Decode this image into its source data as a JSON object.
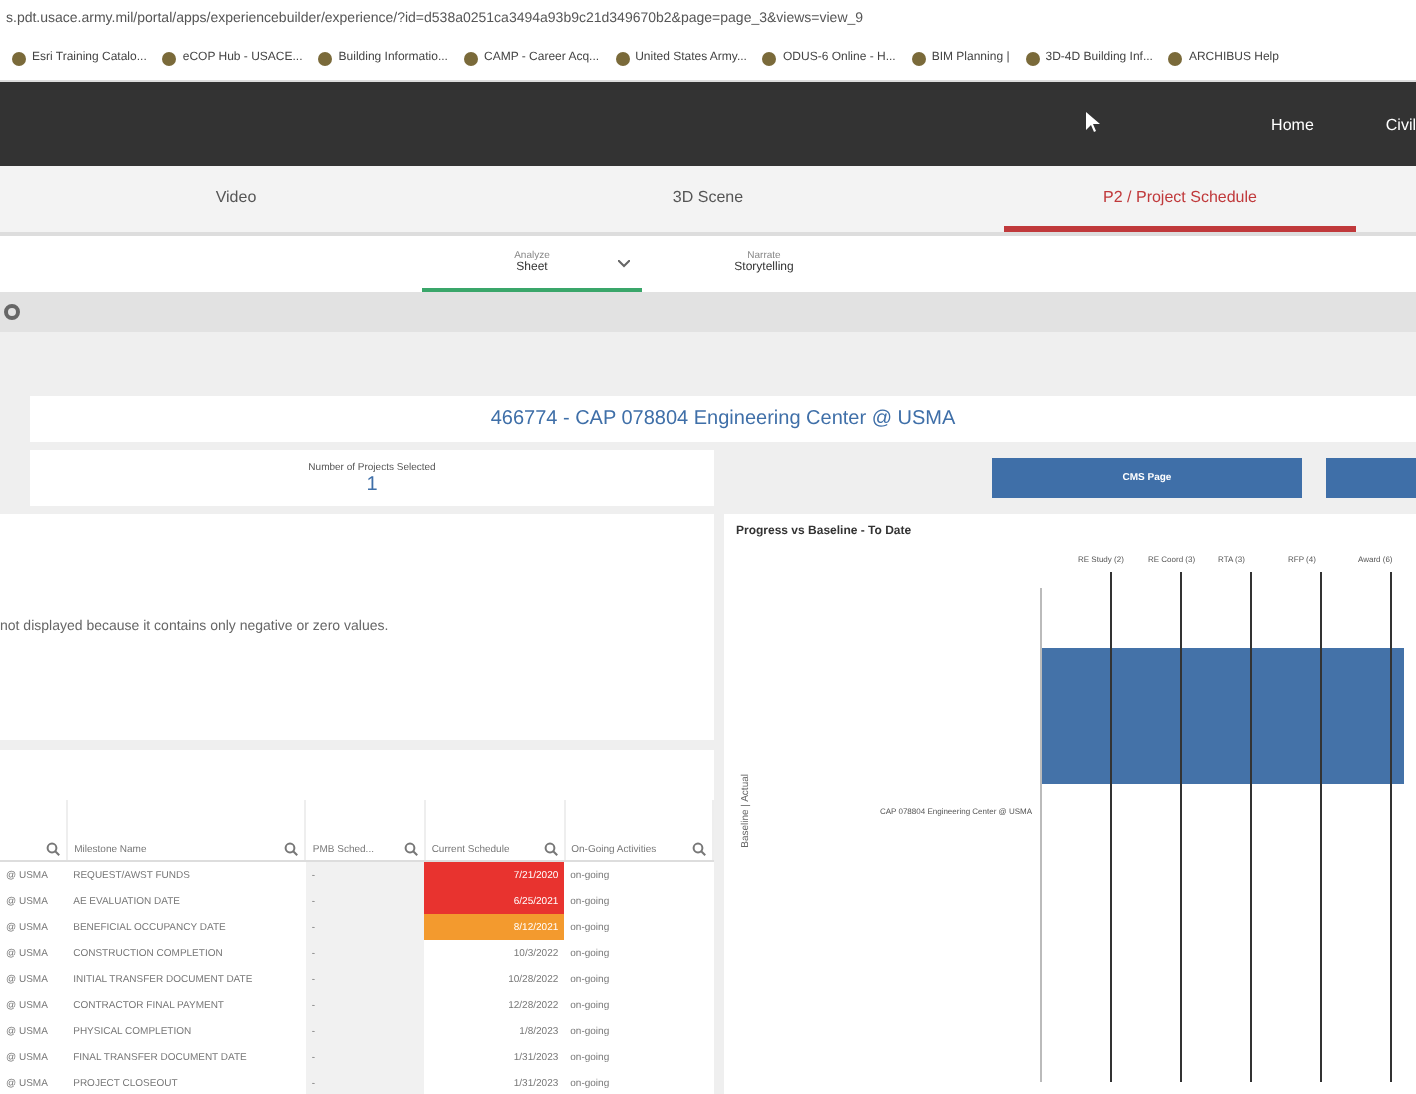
{
  "browser": {
    "url": "s.pdt.usace.army.mil/portal/apps/experiencebuilder/experience/?id=d538a0251ca3494a93b9c21d349670b2&page=page_3&views=view_9",
    "bookmarks": [
      "Esri Training Catalo...",
      "eCOP Hub - USACE...",
      "Building Informatio...",
      "CAMP - Career Acq...",
      "United States Army...",
      "ODUS-6 Online - H...",
      "BIM Planning |",
      "3D-4D Building Inf...",
      "ARCHIBUS Help"
    ]
  },
  "header": {
    "nav": [
      "Home",
      "Civil"
    ]
  },
  "tabs": [
    {
      "label": "Video",
      "selected": false
    },
    {
      "label": "3D Scene",
      "selected": false
    },
    {
      "label": "P2 / Project Schedule",
      "selected": true
    }
  ],
  "views": [
    {
      "caption": "Analyze",
      "label": "Sheet",
      "selected": true,
      "dropdown": true
    },
    {
      "caption": "Narrate",
      "label": "Storytelling",
      "selected": false,
      "dropdown": false
    }
  ],
  "title": "466774 - CAP 078804 Engineering Center @ USMA",
  "kpi": {
    "label": "Number of Projects Selected",
    "value": "1"
  },
  "buttons": [
    {
      "kind": "labeled",
      "label": "CMS Page"
    },
    {
      "kind": "blank"
    }
  ],
  "message": "not displayed because it contains only negative or zero values.",
  "table": {
    "columns": [
      "",
      "Milestone Name",
      "PMB Sched...",
      "Current Schedule",
      "On-Going Activities"
    ],
    "rows": [
      {
        "cells": [
          "@ USMA",
          "REQUEST/AWST FUNDS",
          "-",
          "7/21/2020",
          "on-going"
        ],
        "color": "#e8332f"
      },
      {
        "cells": [
          "@ USMA",
          "AE EVALUATION DATE",
          "-",
          "6/25/2021",
          "on-going"
        ],
        "color": "#e8332f"
      },
      {
        "cells": [
          "@ USMA",
          "BENEFICIAL OCCUPANCY DATE",
          "-",
          "8/12/2021",
          "on-going"
        ],
        "color": "#f39a2e"
      },
      {
        "cells": [
          "@ USMA",
          "CONSTRUCTION COMPLETION",
          "-",
          "10/3/2022",
          "on-going"
        ]
      },
      {
        "cells": [
          "@ USMA",
          "INITIAL TRANSFER DOCUMENT DATE",
          "-",
          "10/28/2022",
          "on-going"
        ]
      },
      {
        "cells": [
          "@ USMA",
          "CONTRACTOR FINAL PAYMENT",
          "-",
          "12/28/2022",
          "on-going"
        ]
      },
      {
        "cells": [
          "@ USMA",
          "PHYSICAL COMPLETION",
          "-",
          "1/8/2023",
          "on-going"
        ]
      },
      {
        "cells": [
          "@ USMA",
          "FINAL TRANSFER DOCUMENT DATE",
          "-",
          "1/31/2023",
          "on-going"
        ]
      },
      {
        "cells": [
          "@ USMA",
          "PROJECT CLOSEOUT",
          "-",
          "1/31/2023",
          "on-going"
        ]
      }
    ]
  },
  "chart": {
    "title": "Progress vs Baseline - To Date",
    "milestones": [
      "RE Study (2)",
      "RE Coord (3)",
      "RTA (3)",
      "RFP (4)",
      "Award (6)"
    ],
    "category": "CAP 078804 Engineering Center @ USMA",
    "axis_title": "Baseline | Actual"
  }
}
